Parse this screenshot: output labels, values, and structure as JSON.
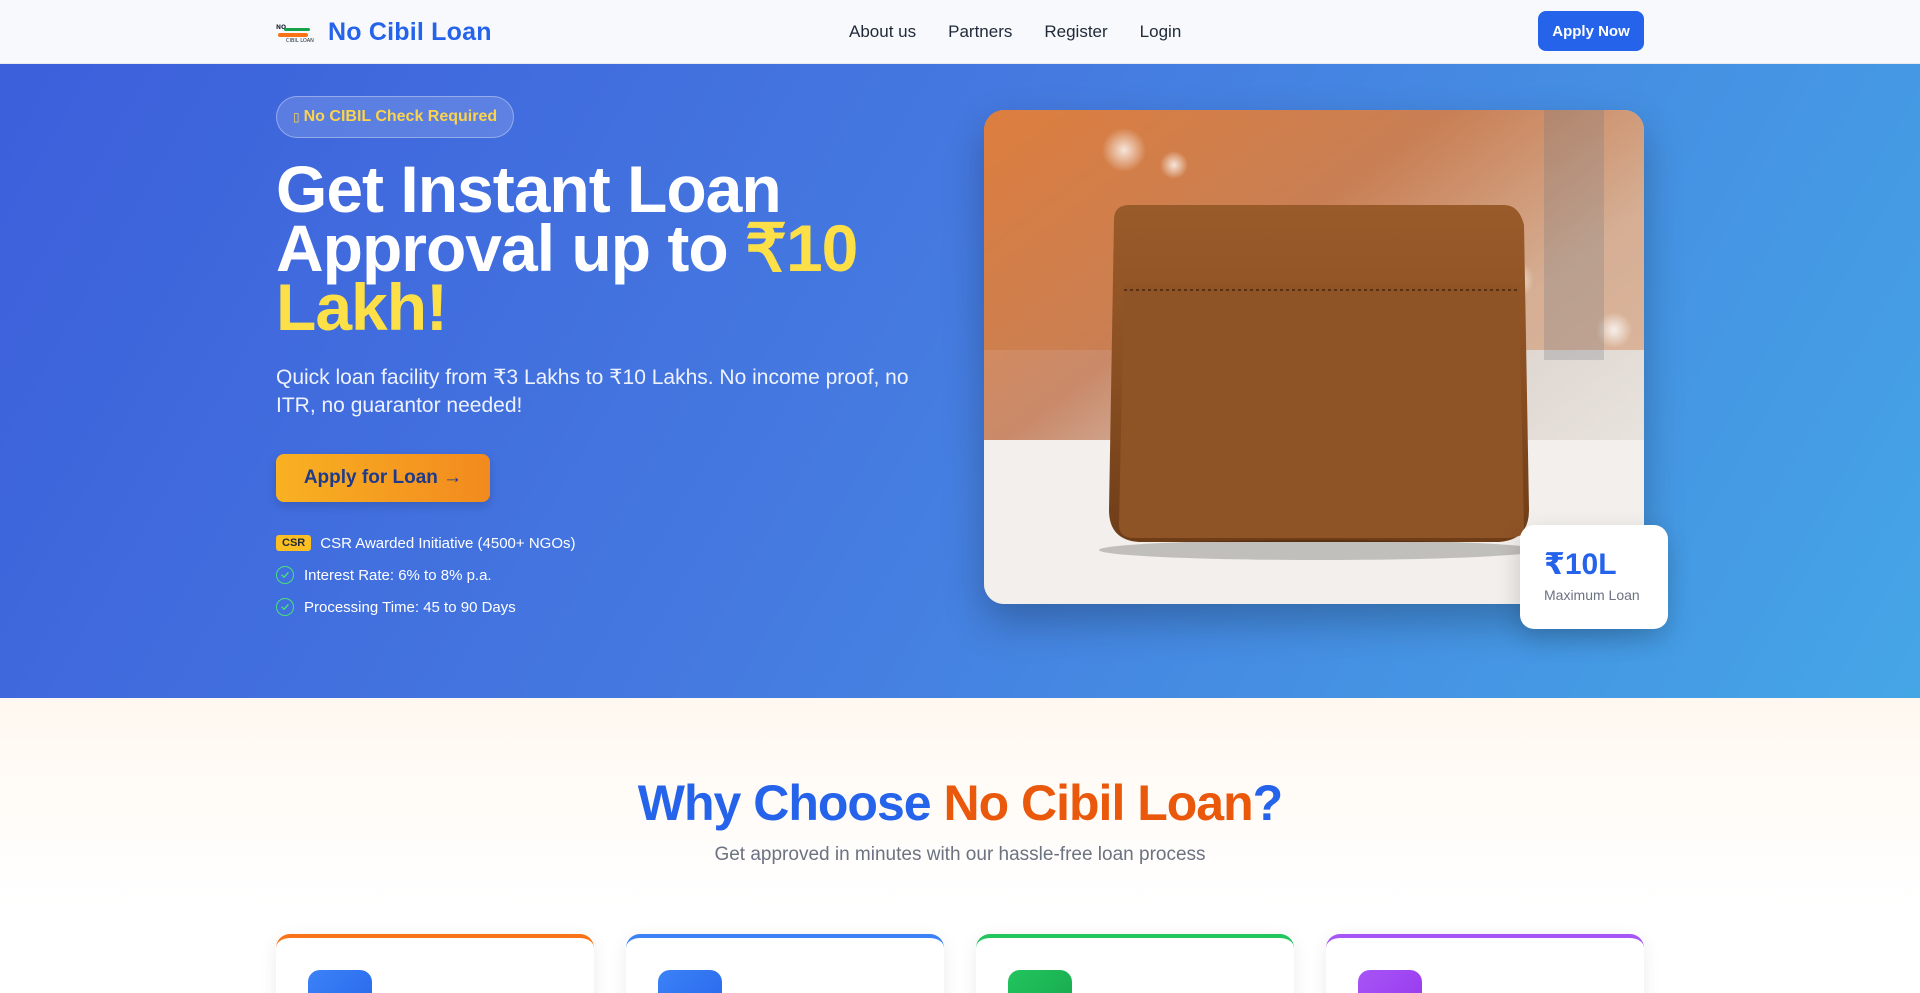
{
  "nav": {
    "brand": "No Cibil Loan",
    "logo_text_top": "NO",
    "logo_text_bottom": "CIBIL LOAN",
    "links": [
      "About us",
      "Partners",
      "Register",
      "Login"
    ],
    "cta": "Apply Now"
  },
  "hero": {
    "badge_icon": "icon",
    "badge": "No CIBIL Check Required",
    "title_line1": "Get Instant Loan",
    "title_line2": "Approval up to ",
    "title_highlight": "₹10 Lakh!",
    "subtitle": "Quick loan facility from ₹3 Lakhs to ₹10 Lakhs. No income proof, no ITR, no guarantor needed!",
    "cta": "Apply for Loan →",
    "features": {
      "csr_tag": "CSR",
      "csr_text": "CSR Awarded Initiative (4500+ NGOs)",
      "interest": "Interest Rate: 6% to 8% p.a.",
      "processing": "Processing Time: 45 to 90 Days"
    },
    "stat": {
      "value": "₹10L",
      "label": "Maximum Loan"
    }
  },
  "why": {
    "title_part1": "Why Choose ",
    "title_part2": "No Cibil Loan",
    "title_part3": "?",
    "subtitle": "Get approved in minutes with our hassle-free loan process",
    "cards": [
      {
        "accent": "#f97316",
        "icon_color": "#2563eb"
      },
      {
        "accent": "#3b82f6",
        "icon_color": "#2563eb"
      },
      {
        "accent": "#22c55e",
        "icon_color": "#16a34a"
      },
      {
        "accent": "#a855f7",
        "icon_color": "#9333ea"
      }
    ]
  },
  "colors": {
    "brand_blue": "#2563eb",
    "accent_orange": "#ea580c",
    "highlight_yellow": "#fde047"
  }
}
